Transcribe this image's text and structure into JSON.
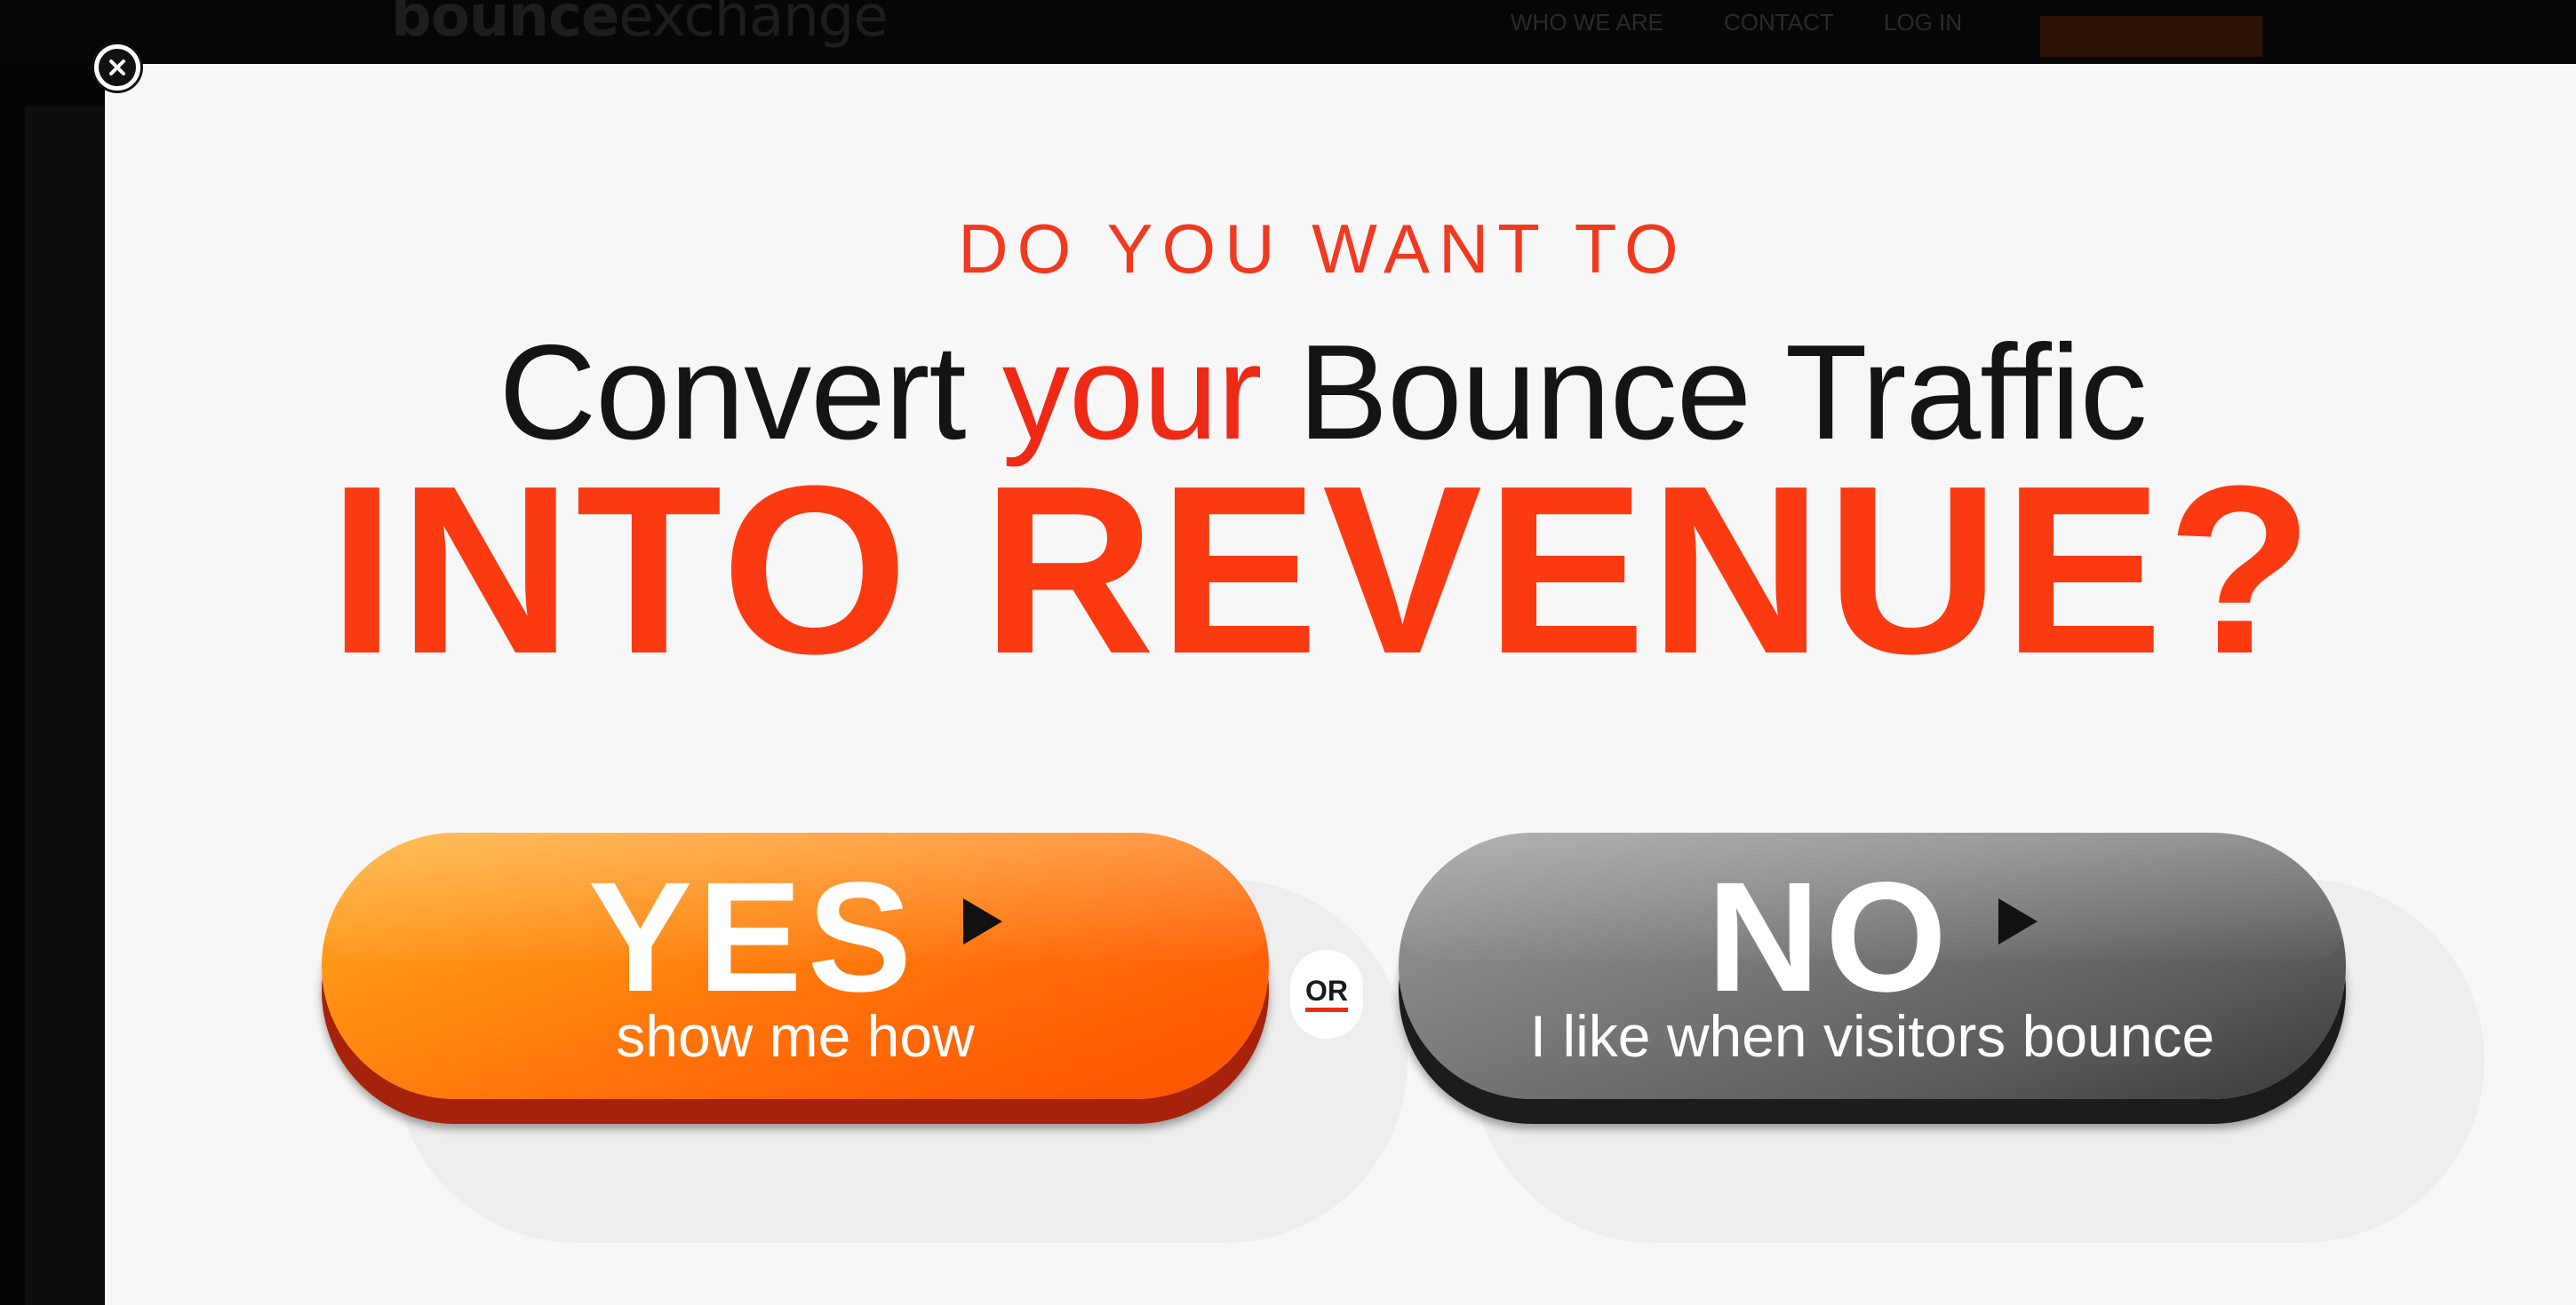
{
  "background_site": {
    "logo_bold": "bounce",
    "logo_thin": "exchange",
    "nav_items": [
      "WHO WE ARE",
      "CONTACT",
      "LOG IN"
    ]
  },
  "modal": {
    "close_icon": "close-icon",
    "kicker": "DO YOU WANT TO",
    "headline_before": "Convert ",
    "headline_accent": "your",
    "headline_after": " Bounce Traffic",
    "headline_emphasis": "INTO REVENUE?",
    "or_label": "OR",
    "yes_button": {
      "main": "YES",
      "sub": "show me how",
      "icon": "play-arrow-icon"
    },
    "no_button": {
      "main": "NO",
      "sub": "I like when visitors bounce",
      "icon": "play-arrow-icon"
    }
  },
  "colors": {
    "accent_red": "#ee2a17",
    "yes_orange": "#ff6a08",
    "no_gray": "#6a6a6a",
    "modal_bg": "#f7f7f7"
  }
}
